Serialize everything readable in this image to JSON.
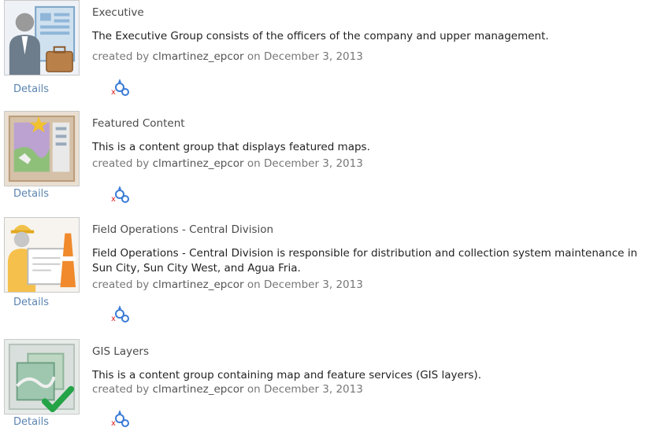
{
  "details_label": "Details",
  "created_prefix": "created by",
  "date_prefix": "on",
  "groups": [
    {
      "title": "Executive",
      "description": "The Executive Group consists of the officers of the company and upper management.",
      "owner": "clmartinez_epcor",
      "date": "December 3, 2013",
      "thumbnail_icon": "executive-icon"
    },
    {
      "title": "Featured Content",
      "description": "This is a content group that displays featured maps.",
      "owner": "clmartinez_epcor",
      "date": "December 3, 2013",
      "thumbnail_icon": "featured-content-icon"
    },
    {
      "title": "Field Operations - Central Division",
      "description": "Field Operations - Central Division is responsible for distribution and collection system maintenance in Sun City, Sun City West, and Agua Fria.",
      "owner": "clmartinez_epcor",
      "date": "December 3, 2013",
      "thumbnail_icon": "field-operations-icon"
    },
    {
      "title": "GIS Layers",
      "description": "This is a content group containing map and feature services (GIS layers).",
      "owner": "clmartinez_epcor",
      "date": "December 3, 2013",
      "thumbnail_icon": "gis-layers-icon"
    }
  ],
  "sharing_icon": "share-group-icon"
}
